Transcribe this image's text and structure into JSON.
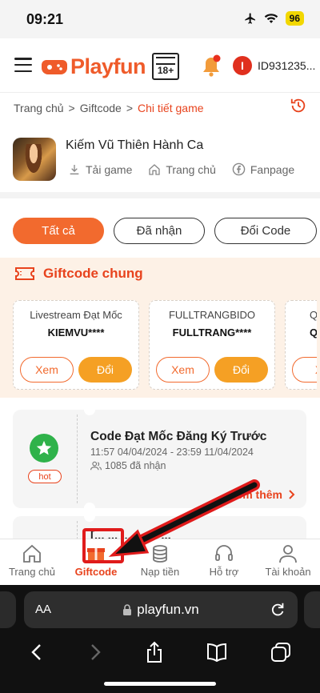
{
  "status_bar": {
    "time": "09:21",
    "battery": "96"
  },
  "header": {
    "logo_text": "Playfun",
    "age_rating": "18+",
    "user_initial": "I",
    "user_id": "ID931235..."
  },
  "breadcrumb": {
    "home": "Trang chủ",
    "sep1": ">",
    "giftcode": "Giftcode",
    "sep2": ">",
    "current": "Chi tiết game"
  },
  "game": {
    "title": "Kiếm Vũ Thiên Hành Ca",
    "links": {
      "download": "Tải game",
      "home": "Trang chủ",
      "fanpage": "Fanpage"
    }
  },
  "tabs": {
    "all": "Tất cả",
    "received": "Đã nhận",
    "exchange": "Đổi Code"
  },
  "giftcode_section": {
    "title": "Giftcode chung",
    "cards": [
      {
        "name": "Livestream Đạt Mốc",
        "code": "KIEMVU****",
        "view": "Xem",
        "redeem": "Đổi"
      },
      {
        "name": "FULLTRANGBIDO",
        "code": "FULLTRANG****",
        "view": "Xem",
        "redeem": "Đổi"
      },
      {
        "name": "Q",
        "code": "Q",
        "view": "Xe"
      }
    ]
  },
  "events": [
    {
      "title": "Code Đạt Mốc Đăng Ký Trước",
      "date": "11:57 04/04/2024 - 23:59 11/04/2024",
      "count": "1085 đã nhận",
      "badge": "hot",
      "more": "Xem thêm"
    },
    {
      "title": "[... ... ... ... ... ..."
    }
  ],
  "bottom_nav": {
    "home": "Trang chủ",
    "giftcode": "Giftcode",
    "topup": "Nạp tiền",
    "support": "Hỗ trợ",
    "account": "Tài khoản"
  },
  "browser": {
    "aa": "AA",
    "url": "playfun.vn"
  },
  "colors": {
    "accent": "#e8431d",
    "orange_button": "#f26a2e",
    "redeem_button": "#f5a024",
    "hot_green": "#2fb24a"
  }
}
